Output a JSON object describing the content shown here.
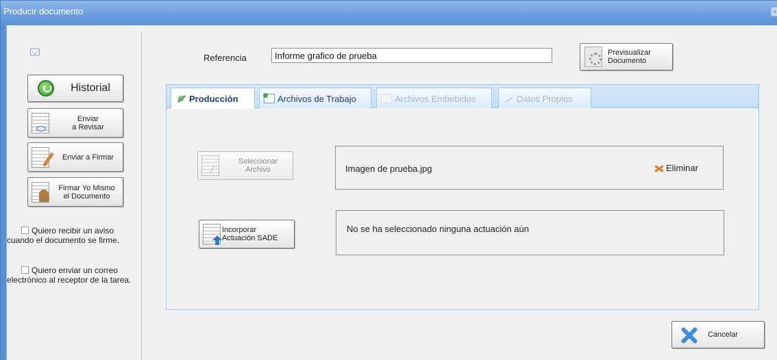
{
  "window": {
    "title": "Producir documento",
    "close_glyph": "×"
  },
  "sidebar": {
    "historial_label": "Historial",
    "enviar_revisar_line1": "Enviar",
    "enviar_revisar_line2": "a Revisar",
    "enviar_firmar_label": "Enviar a Firmar",
    "firmar_yo_line1": "Firmar Yo Mismo",
    "firmar_yo_line2": "el Documento",
    "checkbox_aviso": "Quiero recibir un aviso cuando el documento se firme.",
    "checkbox_correo": "Quiero enviar un correo electrónico al receptor de la tarea."
  },
  "header": {
    "referencia_label": "Referencia",
    "referencia_value": "Informe grafico de prueba",
    "preview_line1": "Previsualizar",
    "preview_line2": "Documento"
  },
  "tabs": [
    {
      "label": "Producción",
      "active": true,
      "enabled": true
    },
    {
      "label": "Archivos de Trabajo",
      "active": false,
      "enabled": true
    },
    {
      "label": "Archivos Embebidos",
      "active": false,
      "enabled": false
    },
    {
      "label": "Datos Propios",
      "active": false,
      "enabled": false
    }
  ],
  "produccion": {
    "seleccionar_line1": "Seleccionar",
    "seleccionar_line2": "Archivo",
    "file_name": "Imagen de prueba.jpg",
    "eliminar_label": "Eliminar",
    "incorporar_line1": "Incorporar",
    "incorporar_line2": "Actuación SADE",
    "actuacion_text": "No se ha seleccionado ninguna actuación aún"
  },
  "footer": {
    "cancelar_label": "Cancelar"
  },
  "colors": {
    "titlebar": "#6a9ddc",
    "tab_bar": "#c5def5",
    "accent_blue": "#3a8fe0",
    "delete_orange": "#e0782a"
  }
}
